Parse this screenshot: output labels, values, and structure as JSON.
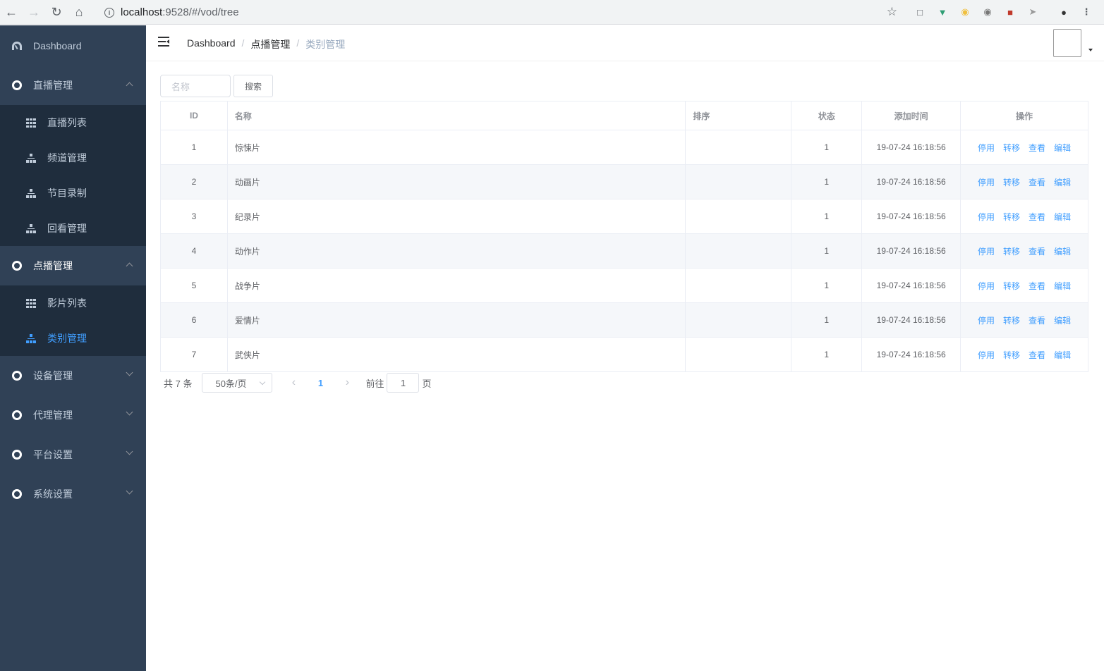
{
  "browser": {
    "url_host": "localhost",
    "url_path": ":9528/#/vod/tree"
  },
  "sidebar": {
    "items": [
      {
        "label": "Dashboard"
      },
      {
        "label": "直播管理",
        "children": [
          "直播列表",
          "频道管理",
          "节目录制",
          "回看管理"
        ]
      },
      {
        "label": "点播管理",
        "children": [
          "影片列表",
          "类别管理"
        ]
      },
      {
        "label": "设备管理"
      },
      {
        "label": "代理管理"
      },
      {
        "label": "平台设置"
      },
      {
        "label": "系统设置"
      }
    ],
    "active_color": "#409eff",
    "background": "#304156"
  },
  "breadcrumb": [
    "Dashboard",
    "点播管理",
    "类别管理"
  ],
  "search": {
    "placeholder": "名称",
    "button": "搜索"
  },
  "table": {
    "columns": [
      "ID",
      "名称",
      "排序",
      "状态",
      "添加时间",
      "操作"
    ],
    "rows": [
      {
        "id": "1",
        "name": "惊悚片",
        "sort": "",
        "status": "1",
        "time": "19-07-24 16:18:56"
      },
      {
        "id": "2",
        "name": "动画片",
        "sort": "",
        "status": "1",
        "time": "19-07-24 16:18:56"
      },
      {
        "id": "3",
        "name": "纪录片",
        "sort": "",
        "status": "1",
        "time": "19-07-24 16:18:56"
      },
      {
        "id": "4",
        "name": "动作片",
        "sort": "",
        "status": "1",
        "time": "19-07-24 16:18:56"
      },
      {
        "id": "5",
        "name": "战争片",
        "sort": "",
        "status": "1",
        "time": "19-07-24 16:18:56"
      },
      {
        "id": "6",
        "name": "爱情片",
        "sort": "",
        "status": "1",
        "time": "19-07-24 16:18:56"
      },
      {
        "id": "7",
        "name": "武侠片",
        "sort": "",
        "status": "1",
        "time": "19-07-24 16:18:56"
      }
    ],
    "actions": [
      "停用",
      "转移",
      "查看",
      "编辑"
    ]
  },
  "pagination": {
    "total": "共 7 条",
    "page_size": "50条/页",
    "current": "1",
    "goto_label": "前往",
    "goto_value": "1",
    "page_unit": "页"
  }
}
